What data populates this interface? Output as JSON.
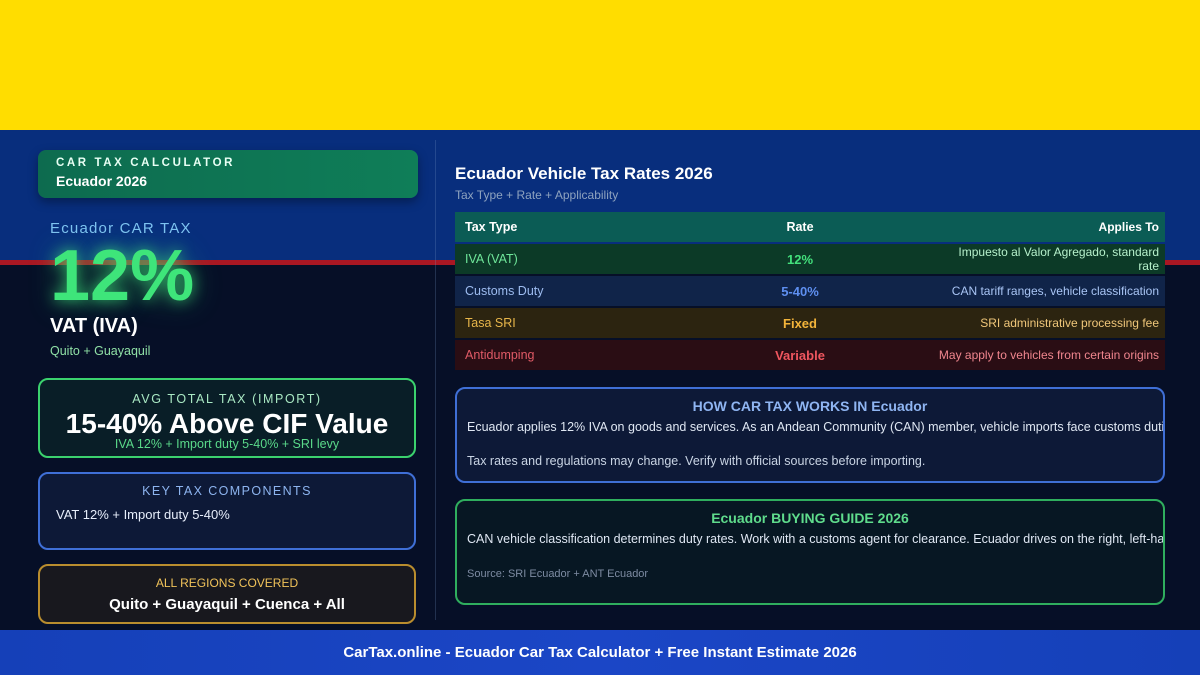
{
  "brand": {
    "kicker": "CAR TAX CALCULATOR",
    "title": "Ecuador 2026"
  },
  "hero": {
    "country_label": "Ecuador CAR TAX",
    "rate": "12%",
    "rate_label": "VAT (IVA)",
    "cities": "Quito + Guayaquil"
  },
  "avg_tax": {
    "kicker": "AVG TOTAL TAX (IMPORT)",
    "value": "15-40% Above CIF Value",
    "sub": "IVA 12% + Import duty 5-40% + SRI levy"
  },
  "components": {
    "kicker": "KEY TAX COMPONENTS",
    "value": "VAT 12% + Import duty 5-40%"
  },
  "regions": {
    "kicker": "ALL REGIONS COVERED",
    "value": "Quito + Guayaquil + Cuenca + All"
  },
  "rates": {
    "title": "Ecuador Vehicle Tax Rates 2026",
    "subtitle": "Tax Type + Rate + Applicability",
    "headers": {
      "type": "Tax Type",
      "rate": "Rate",
      "applies": "Applies To"
    },
    "rows": [
      {
        "type": "IVA (VAT)",
        "rate": "12%",
        "applies": "Impuesto al Valor Agregado, standard rate"
      },
      {
        "type": "Customs Duty",
        "rate": "5-40%",
        "applies": "CAN tariff ranges, vehicle classification"
      },
      {
        "type": "Tasa SRI",
        "rate": "Fixed",
        "applies": "SRI administrative processing fee"
      },
      {
        "type": "Antidumping",
        "rate": "Variable",
        "applies": "May apply to vehicles from certain origins"
      }
    ]
  },
  "how_it_works": {
    "title": "HOW CAR TAX WORKS IN Ecuador",
    "text": "Ecuador applies 12% IVA on goods and services. As an Andean Community (CAN) member, vehicle imports face customs duties",
    "note": "Tax rates and regulations may change. Verify with official sources before importing."
  },
  "guide": {
    "title": "Ecuador BUYING GUIDE 2026",
    "text": "CAN vehicle classification determines duty rates. Work with a customs agent for clearance. Ecuador drives on the right, left-hand",
    "source": "Source: SRI Ecuador + ANT Ecuador"
  },
  "footer": {
    "text": "CarTax.online - Ecuador Car Tax Calculator + Free Instant Estimate 2026"
  },
  "colors": {
    "flag_yellow": "#ffdd00",
    "flag_blue": "#0a3a9c",
    "flag_red": "#e01b24",
    "accent_green": "#3ee57a",
    "footer_blue": "#1b46c6"
  }
}
